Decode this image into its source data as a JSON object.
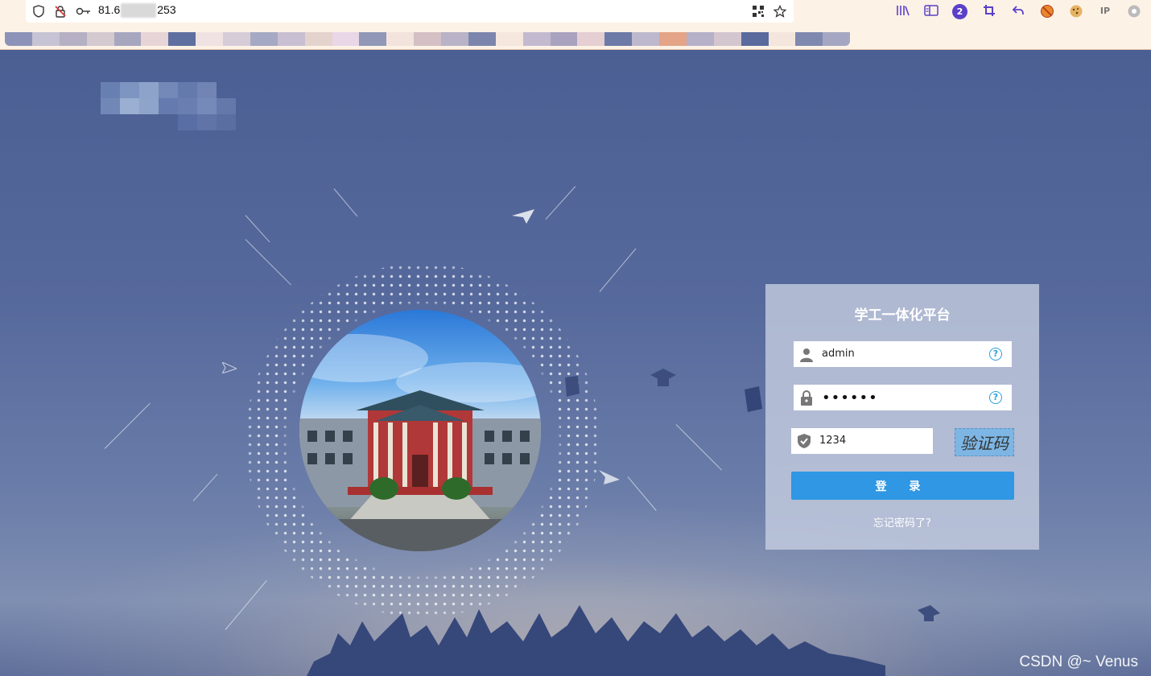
{
  "browser": {
    "url_start": "81.6",
    "url_end": "253",
    "badge_count": "2",
    "ip_label": "IP"
  },
  "login": {
    "title": "学工一体化平台",
    "username_value": "admin",
    "password_masked": "••••••",
    "captcha_input_value": "1234",
    "captcha_image_text": "验证码",
    "login_button": "登 录",
    "forgot_link": "忘记密码了?",
    "help_glyph": "?"
  },
  "colors": {
    "login_button": "#2f97e4",
    "help_icon": "#2aa0d8",
    "background": "#4b5f94"
  },
  "watermark": "CSDN @~ Venus"
}
